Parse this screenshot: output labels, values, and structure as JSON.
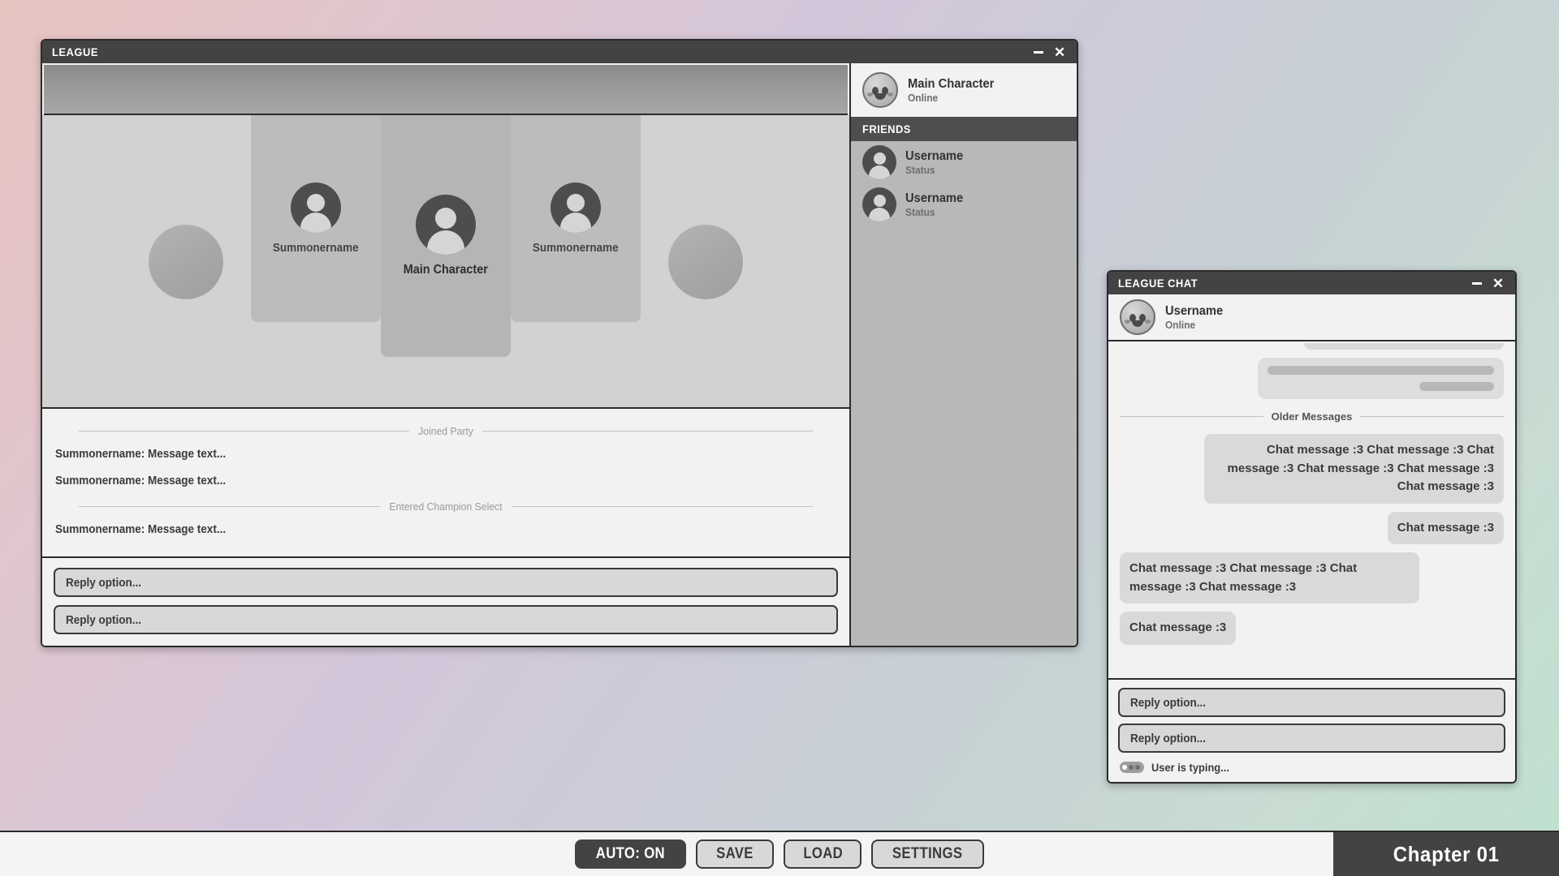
{
  "league_window": {
    "title": "LEAGUE",
    "minimize_icon": "minimize-icon",
    "close_icon": "close-icon",
    "party": {
      "slots": [
        {
          "type": "empty",
          "name": ""
        },
        {
          "type": "teammate",
          "name": "Summonername"
        },
        {
          "type": "main",
          "name": "Main Character"
        },
        {
          "type": "teammate",
          "name": "Summonername"
        },
        {
          "type": "empty",
          "name": ""
        }
      ]
    },
    "log": {
      "entries": [
        {
          "kind": "divider",
          "text": "Joined Party"
        },
        {
          "kind": "message",
          "text": "Summonername: Message text..."
        },
        {
          "kind": "message",
          "text": "Summonername: Message text..."
        },
        {
          "kind": "divider",
          "text": "Entered Champion Select"
        },
        {
          "kind": "message",
          "text": "Summonername: Message text..."
        }
      ]
    },
    "replies": [
      {
        "label": "Reply option..."
      },
      {
        "label": "Reply option..."
      }
    ],
    "sidebar": {
      "me": {
        "name": "Main Character",
        "status": "Online",
        "avatar": "poro-avatar"
      },
      "section_title": "FRIENDS",
      "friends": [
        {
          "name": "Username",
          "status": "Status",
          "avatar": "person-avatar"
        },
        {
          "name": "Username",
          "status": "Status",
          "avatar": "person-avatar"
        }
      ]
    }
  },
  "chat_window": {
    "title": "LEAGUE CHAT",
    "minimize_icon": "minimize-icon",
    "close_icon": "close-icon",
    "contact": {
      "name": "Username",
      "status": "Online",
      "avatar": "poro-avatar"
    },
    "messages": [
      {
        "kind": "clipped-bubble",
        "side": "right",
        "text": ""
      },
      {
        "kind": "skeleton",
        "side": "right",
        "text": ""
      },
      {
        "kind": "divider",
        "text": "Older Messages"
      },
      {
        "kind": "bubble",
        "side": "right",
        "text": "Chat message :3 Chat message :3 Chat message :3 Chat message :3 Chat message :3 Chat message :3"
      },
      {
        "kind": "bubble",
        "side": "right",
        "text": "Chat message :3"
      },
      {
        "kind": "bubble",
        "side": "left",
        "text": "Chat message :3 Chat message :3 Chat message :3 Chat message :3"
      },
      {
        "kind": "bubble",
        "side": "left",
        "text": "Chat message :3"
      }
    ],
    "replies": [
      {
        "label": "Reply option..."
      },
      {
        "label": "Reply option..."
      }
    ],
    "typing": {
      "text": "User is typing...",
      "icon": "typing-dots-icon"
    }
  },
  "bottom_bar": {
    "buttons": [
      {
        "label": "AUTO: ON",
        "active": true
      },
      {
        "label": "SAVE",
        "active": false
      },
      {
        "label": "LOAD",
        "active": false
      },
      {
        "label": "SETTINGS",
        "active": false
      }
    ],
    "chapter": "Chapter 01"
  },
  "colors": {
    "chrome_dark": "#434343",
    "window_bg": "#f2f2f2",
    "sidebar_bg": "#b8b8b8",
    "bubble_bg": "#d9d9d9",
    "button_bg": "#d8d8d8",
    "text_dark": "#3b3b3b"
  }
}
